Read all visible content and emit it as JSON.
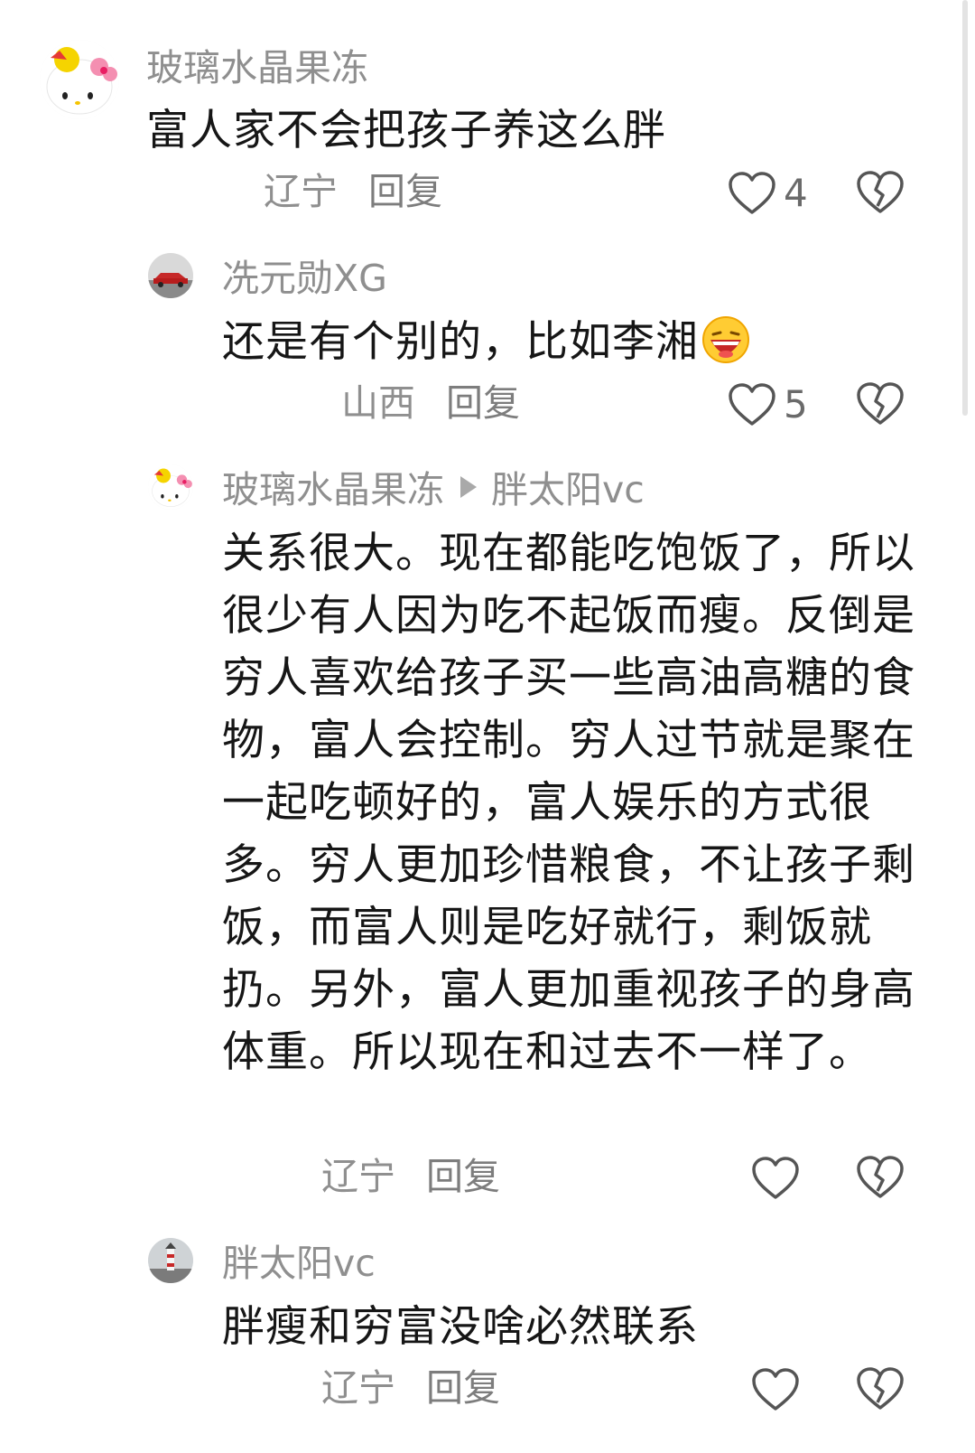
{
  "comments": [
    {
      "username": "玻璃水晶果冻",
      "content": "富人家不会把孩子养这么胖",
      "location": "辽宁",
      "reply_label": "回复",
      "likes": "4",
      "avatar_icon": "hello-kitty-avatar"
    },
    {
      "username": "冼元勋XG",
      "content": "还是有个别的，比如李湘",
      "emoji_icon": "laughing-emoji",
      "location": "山西",
      "reply_label": "回复",
      "likes": "5",
      "avatar_icon": "red-car-avatar"
    },
    {
      "username": "玻璃水晶果冻",
      "reply_to": "胖太阳vc",
      "content": "关系很大。现在都能吃饱饭了，所以很少有人因为吃不起饭而瘦。反倒是穷人喜欢给孩子买一些高油高糖的食物，富人会控制。穷人过节就是聚在一起吃顿好的，富人娱乐的方式很多。穷人更加珍惜粮食，不让孩子剩饭，而富人则是吃好就行，剩饭就扔。另外，富人更加重视孩子的身高体重。所以现在和过去不一样了。",
      "location": "辽宁",
      "reply_label": "回复",
      "likes": "",
      "avatar_icon": "hello-kitty-avatar"
    },
    {
      "username": "胖太阳vc",
      "content": "胖瘦和穷富没啥必然联系",
      "location": "辽宁",
      "reply_label": "回复",
      "likes": "",
      "avatar_icon": "lighthouse-avatar"
    }
  ],
  "colors": {
    "username": "#8f8f8f",
    "content": "#161616",
    "icon": "#555555"
  }
}
